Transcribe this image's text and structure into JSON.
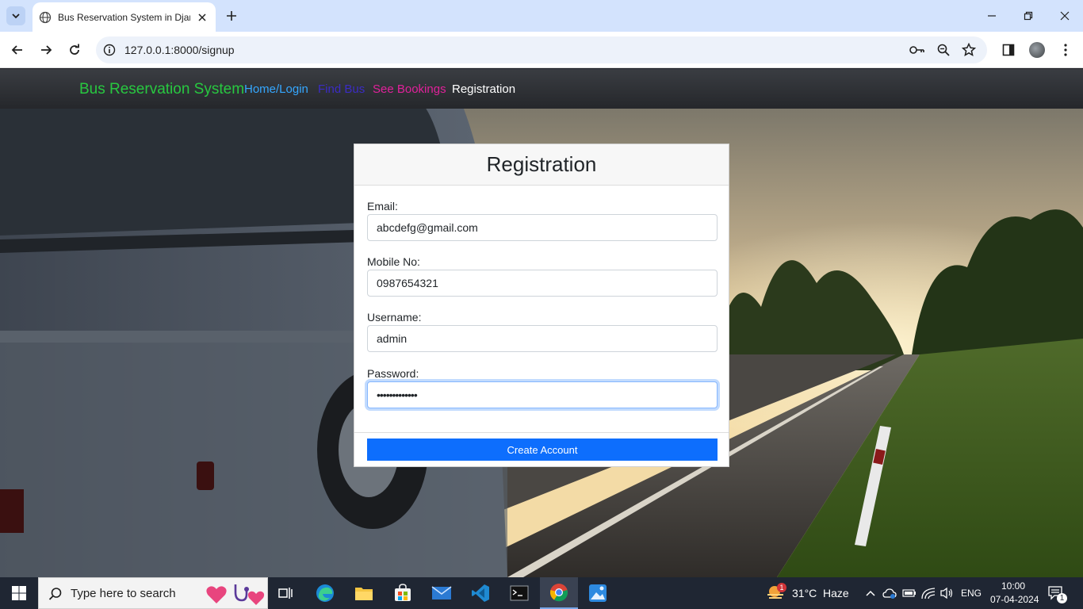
{
  "browser": {
    "tab_title": "Bus Reservation System in Djan",
    "url": "127.0.0.1:8000/signup"
  },
  "navbar": {
    "brand": "Bus Reservation System",
    "links": [
      {
        "label": "Home/Login",
        "color": "#35a7ff"
      },
      {
        "label": "Find Bus",
        "color": "#3b2cc4"
      },
      {
        "label": "See Bookings",
        "color": "#e0219a"
      },
      {
        "label": "Registration",
        "color": "#ffffff"
      }
    ]
  },
  "form": {
    "title": "Registration",
    "fields": [
      {
        "label": "Email:",
        "value": "abcdefg@gmail.com"
      },
      {
        "label": "Mobile No:",
        "value": "0987654321"
      },
      {
        "label": "Username:",
        "value": "admin"
      },
      {
        "label": "Password:",
        "value": "•••••••••••••"
      }
    ],
    "submit_label": "Create Account",
    "accent": "#0d6efd"
  },
  "taskbar": {
    "search_placeholder": "Type here to search",
    "weather_temp": "31°C",
    "weather_text": "Haze",
    "weather_badge": "1",
    "language": "ENG",
    "time": "10:00",
    "date": "07-04-2024",
    "notification_count": "1"
  }
}
